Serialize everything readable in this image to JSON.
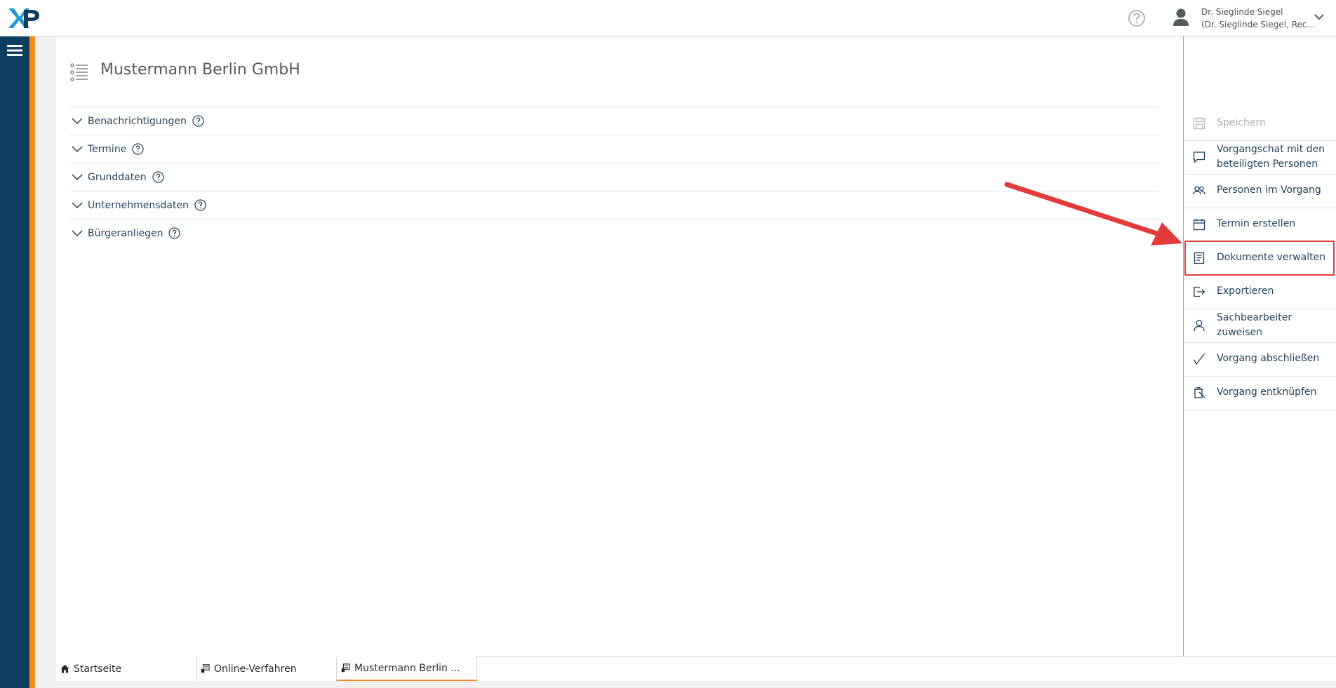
{
  "header": {
    "logo_text": "XP",
    "user_name": "Dr. Sieglinde Siegel",
    "user_sub": "(Dr. Sieglinde Siegel, Rec...",
    "icons": [
      "help-icon",
      "user-icon",
      "chevron-down-icon"
    ]
  },
  "sidebar": {
    "menu_icon": "hamburger-icon"
  },
  "main": {
    "title": "Mustermann Berlin GmbH",
    "sections": [
      {
        "label": "Benachrichtigungen"
      },
      {
        "label": "Termine"
      },
      {
        "label": "Grunddaten"
      },
      {
        "label": "Unternehmensdaten"
      },
      {
        "label": "Bürgeranliegen"
      }
    ]
  },
  "actions": [
    {
      "label": "Speichern",
      "icon": "save-icon",
      "disabled": true
    },
    {
      "label": "Vorgangschat mit den beteiligten Personen",
      "icon": "chat-icon"
    },
    {
      "label": "Personen im Vorgang",
      "icon": "people-icon"
    },
    {
      "label": "Termin erstellen",
      "icon": "calendar-icon"
    },
    {
      "label": "Dokumente verwalten",
      "icon": "document-icon",
      "highlighted": true
    },
    {
      "label": "Exportieren",
      "icon": "export-icon"
    },
    {
      "label": "Sachbearbeiter zuweisen",
      "icon": "person-icon"
    },
    {
      "label": "Vorgang abschließen",
      "icon": "check-icon"
    },
    {
      "label": "Vorgang entknüpfen",
      "icon": "unlink-icon"
    }
  ],
  "tabs": [
    {
      "label": "Startseite",
      "icon": "home-icon"
    },
    {
      "label": "Online-Verfahren",
      "icon": "procedure-icon"
    },
    {
      "label": "Mustermann Berlin ...",
      "icon": "procedure-icon",
      "active": true
    }
  ],
  "colors": {
    "navy": "#0c3d60",
    "orange": "#f28c18",
    "highlight": "#e23b3b"
  }
}
